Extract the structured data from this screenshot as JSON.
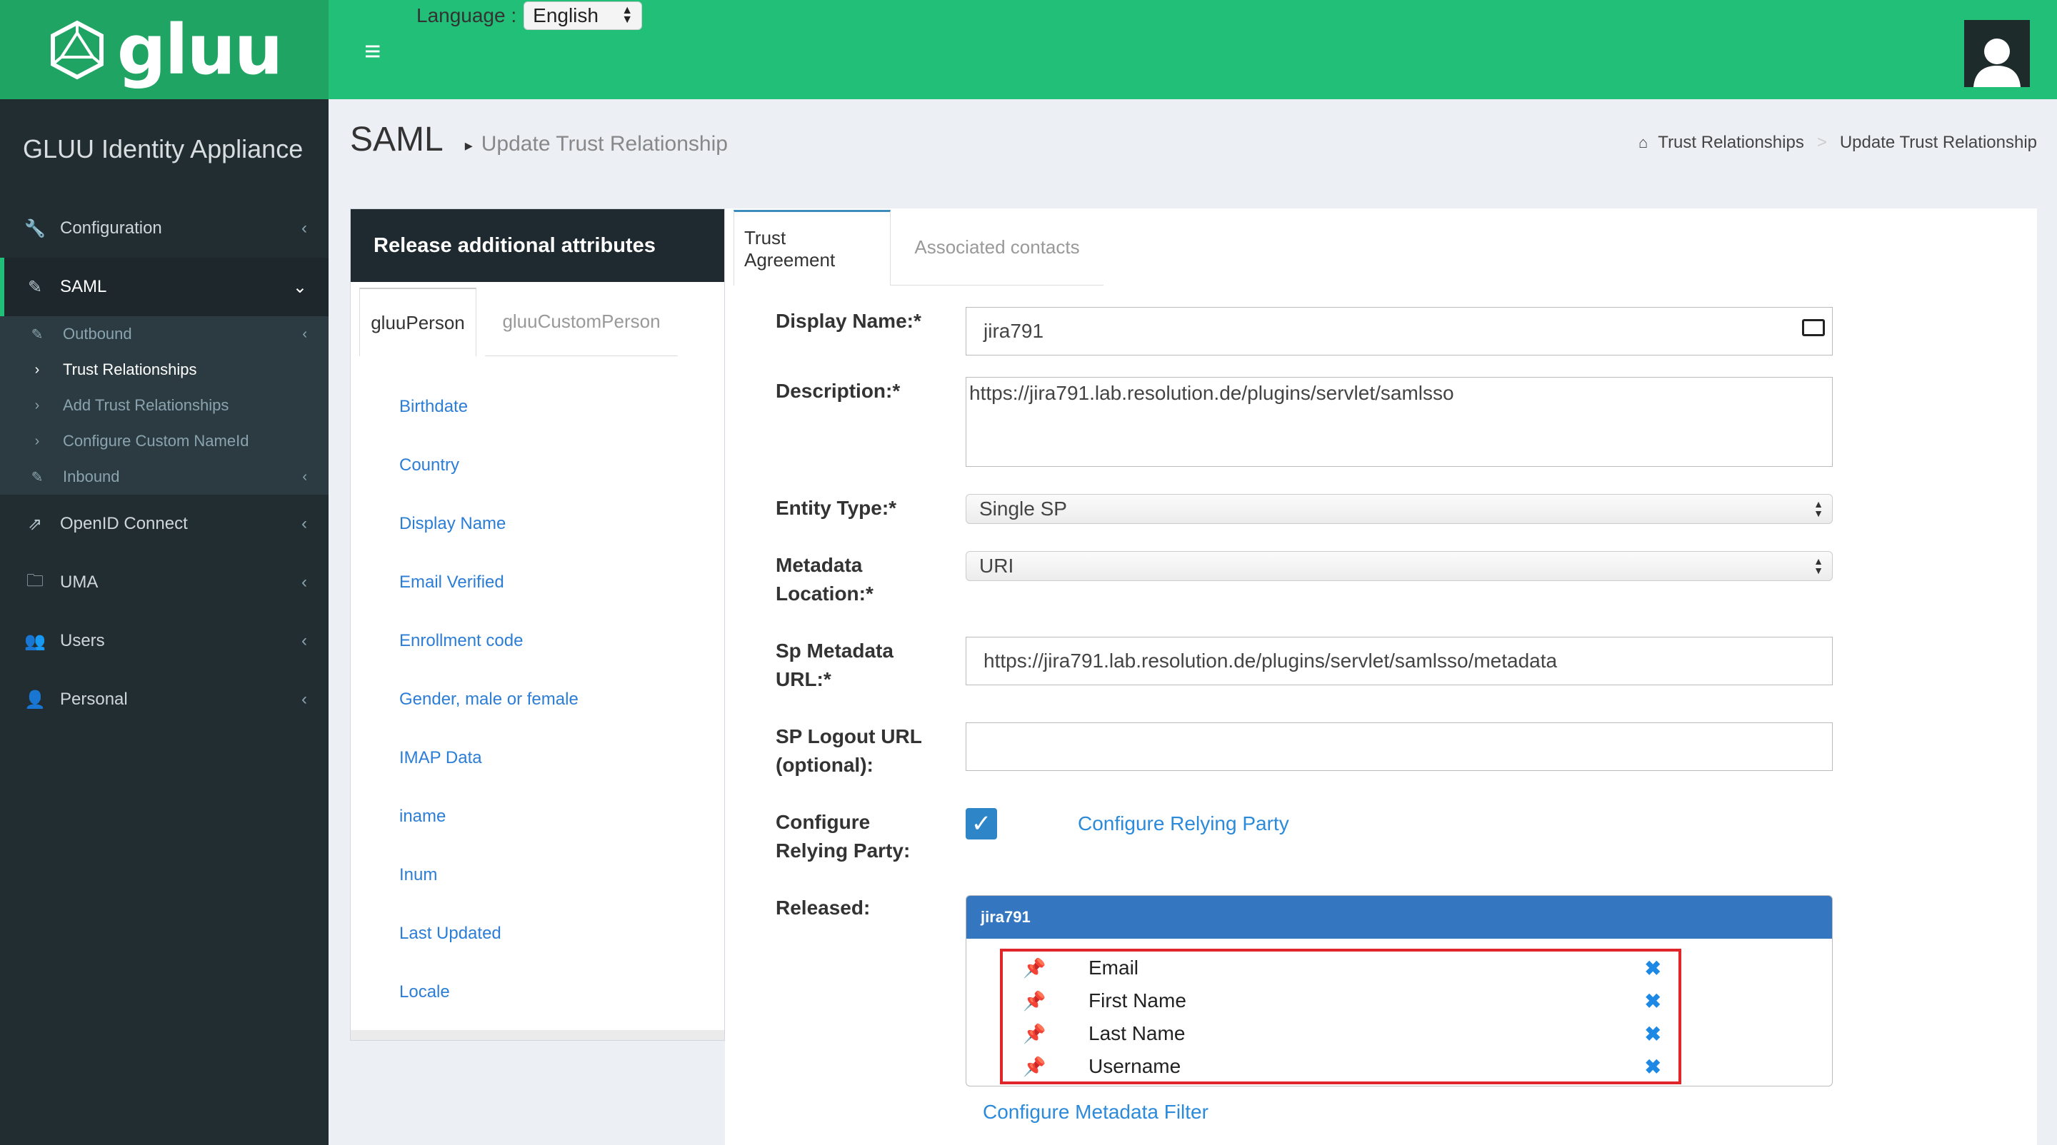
{
  "header": {
    "logo_text": "gluu",
    "language_label": "Language :",
    "language_value": "English",
    "menu_icon": "hamburger-icon",
    "avatar_icon": "user-icon"
  },
  "sidebar": {
    "brand": "GLUU Identity Appliance",
    "items": [
      {
        "label": "Configuration",
        "icon": "wrench-icon"
      },
      {
        "label": "SAML",
        "icon": "edit-icon"
      },
      {
        "label": "OpenID Connect",
        "icon": "external-link-icon"
      },
      {
        "label": "UMA",
        "icon": "folder-icon"
      },
      {
        "label": "Users",
        "icon": "users-icon"
      },
      {
        "label": "Personal",
        "icon": "user-icon"
      }
    ],
    "saml_sub": [
      {
        "label": "Outbound",
        "icon": "edit-icon"
      },
      {
        "label": "Trust Relationships",
        "icon": "chevron-right-icon"
      },
      {
        "label": "Add Trust Relationships",
        "icon": "chevron-right-icon"
      },
      {
        "label": "Configure Custom NameId",
        "icon": "chevron-right-icon"
      },
      {
        "label": "Inbound",
        "icon": "edit-icon"
      }
    ]
  },
  "page": {
    "title": "SAML",
    "subtitle": "Update Trust Relationship",
    "breadcrumb": [
      "Trust Relationships",
      "Update Trust Relationship"
    ]
  },
  "left_panel": {
    "title": "Release additional attributes",
    "tabs": [
      "gluuPerson",
      "gluuCustomPerson"
    ],
    "attributes": [
      "Birthdate",
      "Country",
      "Display Name",
      "Email Verified",
      "Enrollment code",
      "Gender, male or female",
      "IMAP Data",
      "iname",
      "Inum",
      "Last Updated",
      "Locale"
    ]
  },
  "form": {
    "tabs": [
      "Trust Agreement",
      "Associated contacts"
    ],
    "display_name_label": "Display Name:*",
    "display_name_value": "jira791",
    "description_label": "Description:*",
    "description_value": "https://jira791.lab.resolution.de/plugins/servlet/samlsso",
    "entity_type_label": "Entity Type:*",
    "entity_type_value": "Single SP",
    "metadata_location_label_1": "Metadata",
    "metadata_location_label_2": "Location:*",
    "metadata_location_value": "URI",
    "sp_metadata_label_1": "Sp Metadata",
    "sp_metadata_label_2": "URL:*",
    "sp_metadata_value": "https://jira791.lab.resolution.de/plugins/servlet/samlsso/metadata",
    "logout_label_1": "SP Logout URL",
    "logout_label_2": "(optional):",
    "logout_value": "",
    "relying_label_1": "Configure",
    "relying_label_2": "Relying Party:",
    "relying_checked": true,
    "relying_link": "Configure Relying Party",
    "released_label": "Released:",
    "released_header": "jira791",
    "released_items": [
      "Email",
      "First Name",
      "Last Name",
      "Username"
    ],
    "metadata_filter_link": "Configure Metadata Filter"
  }
}
